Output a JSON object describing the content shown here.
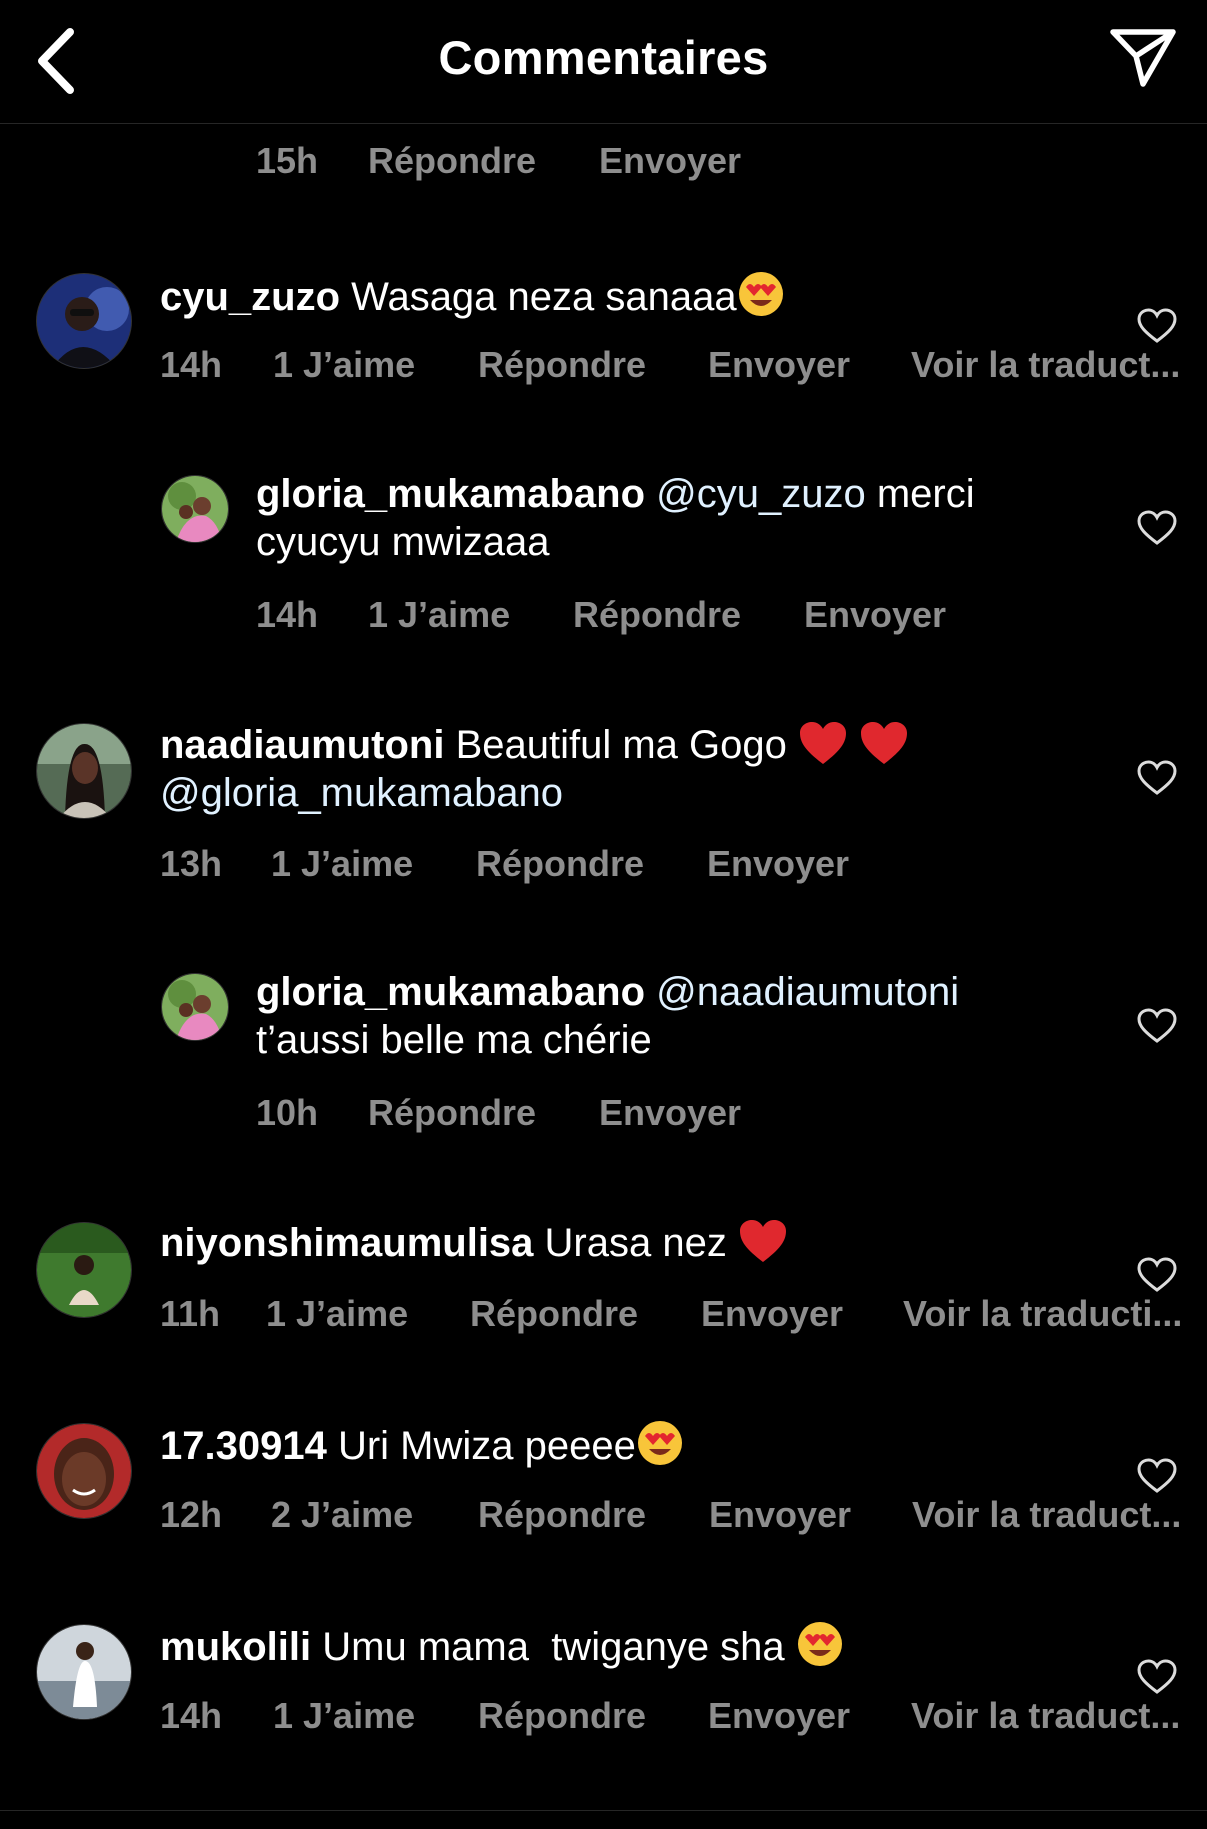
{
  "header": {
    "title": "Commentaires",
    "back_icon": "chevron-left-icon",
    "send_icon": "paper-plane-icon"
  },
  "top_meta": {
    "time": "15h",
    "reply": "Répondre",
    "send": "Envoyer"
  },
  "comments": [
    {
      "username": "cyu_zuzo",
      "text": "Wasaga neza sanaaa",
      "emoji": "heart-eyes",
      "time": "14h",
      "likes": "1 J’aime",
      "reply": "Répondre",
      "send": "Envoyer",
      "translate": "Voir la traduct..."
    },
    {
      "username": "gloria_mukamabano",
      "mention": "@cyu_zuzo",
      "text": " merci",
      "text2": "cyucyu mwizaaa",
      "time": "14h",
      "likes": "1 J’aime",
      "reply": "Répondre",
      "send": "Envoyer"
    },
    {
      "username": "naadiaumutoni",
      "text": "Beautiful ma Gogo",
      "emoji": "red-heart-x2",
      "mention": "@gloria_mukamabano",
      "time": "13h",
      "likes": "1 J’aime",
      "reply": "Répondre",
      "send": "Envoyer"
    },
    {
      "username": "gloria_mukamabano",
      "mention": "@naadiaumutoni",
      "text2": "t’aussi belle ma chérie",
      "time": "10h",
      "reply": "Répondre",
      "send": "Envoyer"
    },
    {
      "username": "niyonshimaumulisa",
      "text": "Urasa nez",
      "emoji": "red-heart",
      "time": "11h",
      "likes": "1 J’aime",
      "reply": "Répondre",
      "send": "Envoyer",
      "translate": "Voir la traducti..."
    },
    {
      "username": "17.30914",
      "text": "Uri Mwiza peeee",
      "emoji": "heart-eyes",
      "time": "12h",
      "likes": "2 J’aime",
      "reply": "Répondre",
      "send": "Envoyer",
      "translate": "Voir la traduct..."
    },
    {
      "username": "mukolili",
      "text": "Umu mama  twiganye sha",
      "emoji": "heart-eyes",
      "time": "14h",
      "likes": "1 J’aime",
      "reply": "Répondre",
      "send": "Envoyer",
      "translate": "Voir la traduct..."
    }
  ],
  "colors": {
    "background": "#000000",
    "text": "#ffffff",
    "meta": "#8e8e8e",
    "mention": "#e0f1ff",
    "emoji_heart": "#e0282e"
  }
}
